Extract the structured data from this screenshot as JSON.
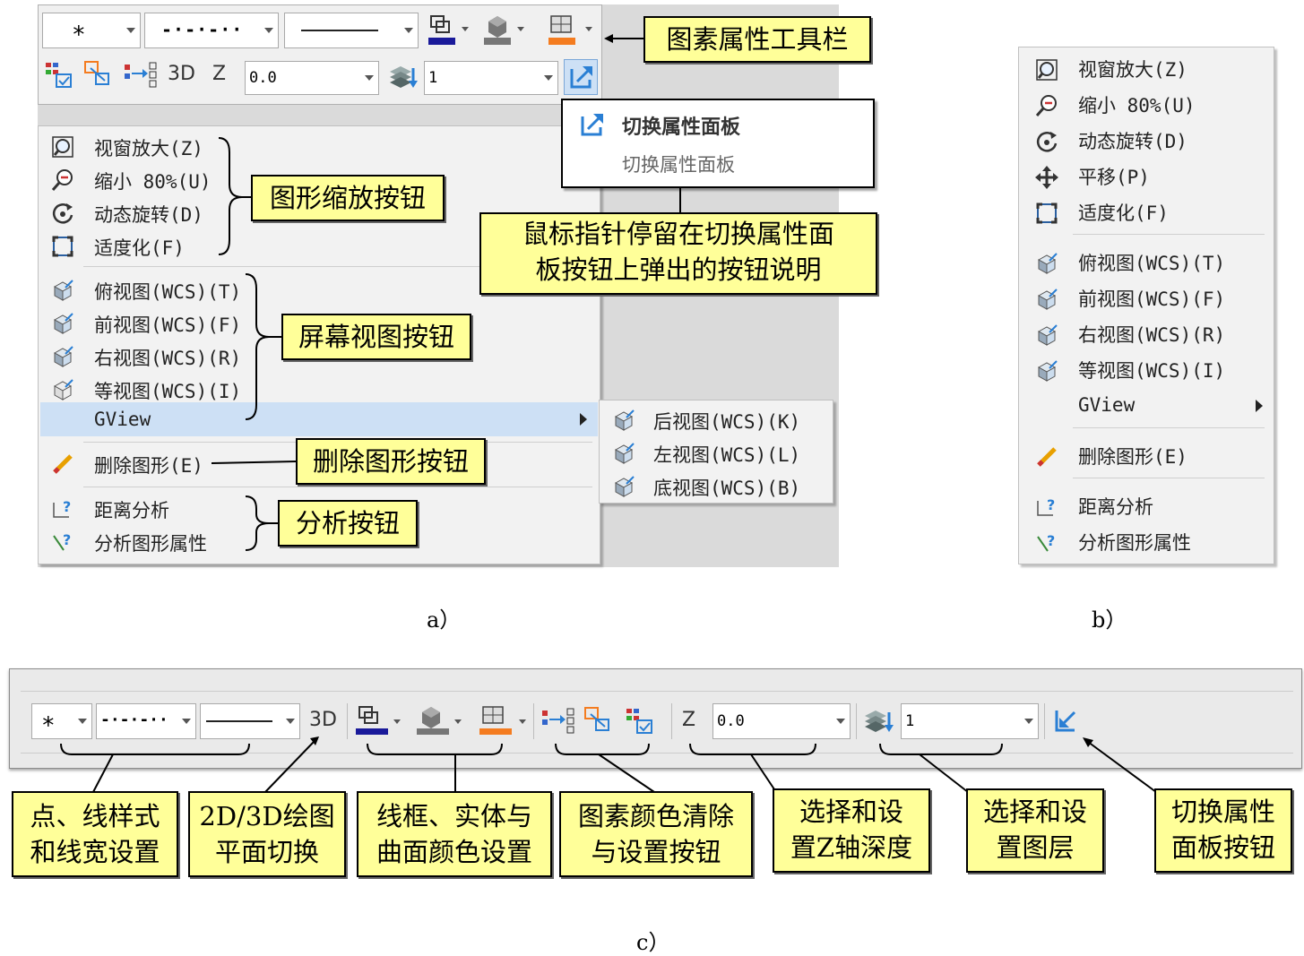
{
  "panel_a": {
    "caption": "a）",
    "toolbar": {
      "point_style": "∗",
      "line_style": "-·-·-··",
      "z_value": "0.0",
      "layer_value": "1",
      "btn_3d": "3D",
      "btn_z": "Z"
    },
    "tooltip": {
      "title": "切换属性面板",
      "desc": "切换属性面板"
    },
    "menu": {
      "zoom_items": [
        "视窗放大(Z)",
        "缩小 80%(U)",
        "动态旋转(D)",
        "适度化(F)"
      ],
      "view_items": [
        "俯视图(WCS)(T)",
        "前视图(WCS)(F)",
        "右视图(WCS)(R)",
        "等视图(WCS)(I)"
      ],
      "gview": "GView",
      "delete": "删除图形(E)",
      "analysis_items": [
        "距离分析",
        "分析图形属性"
      ]
    },
    "submenu": [
      "后视图(WCS)(K)",
      "左视图(WCS)(L)",
      "底视图(WCS)(B)"
    ],
    "callouts": {
      "toolbar": "图素属性工具栏",
      "zoom": "图形缩放按钮",
      "tooltip_line1": "鼠标指针停留在切换属性面",
      "tooltip_line2": "板按钮上弹出的按钮说明",
      "view": "屏幕视图按钮",
      "delete": "删除图形按钮",
      "analysis": "分析按钮"
    }
  },
  "panel_b": {
    "caption": "b）",
    "items": [
      "视窗放大(Z)",
      "缩小 80%(U)",
      "动态旋转(D)",
      "平移(P)",
      "适度化(F)",
      "俯视图(WCS)(T)",
      "前视图(WCS)(F)",
      "右视图(WCS)(R)",
      "等视图(WCS)(I)",
      "GView",
      "删除图形(E)",
      "距离分析",
      "分析图形属性"
    ]
  },
  "panel_c": {
    "caption": "c）",
    "toolbar": {
      "point_style": "∗",
      "line_style": "-·-·-··",
      "btn_3d": "3D",
      "btn_z": "Z",
      "z_value": "0.0",
      "layer_value": "1"
    },
    "callouts": [
      {
        "l1": "点、线样式",
        "l2": "和线宽设置"
      },
      {
        "l1": "2D/3D绘图",
        "l2": "平面切换"
      },
      {
        "l1": "线框、实体与",
        "l2": "曲面颜色设置"
      },
      {
        "l1": "图素颜色清除",
        "l2": "与设置按钮"
      },
      {
        "l1": "选择和设",
        "l2": "置Z轴深度"
      },
      {
        "l1": "选择和设",
        "l2": "置图层"
      },
      {
        "l1": "切换属性",
        "l2": "面板按钮"
      }
    ]
  },
  "colors": {
    "callout_fill": "#ffff99",
    "wireframe_blue": "#1a1a9a",
    "surface_orange": "#f47c20",
    "icon_blue": "#2a7fd4"
  }
}
